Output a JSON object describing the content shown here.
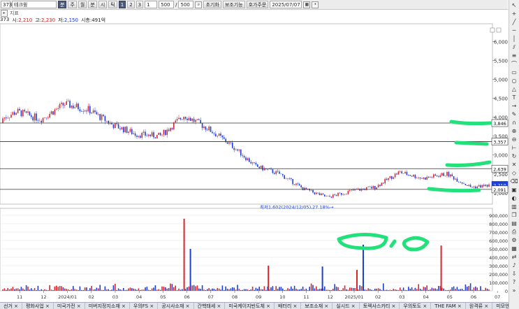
{
  "toolbar": {
    "code": "373",
    "name": "테크윙",
    "period_buttons": [
      "분",
      "주",
      "월",
      "분",
      "시",
      "틱"
    ],
    "selected_period_index": 0,
    "number_buttons": [
      "1",
      "2",
      "3"
    ],
    "selected_number_index": 0,
    "unit_value": "1",
    "count_value": "500",
    "page_value": "500",
    "init_button": "초기화",
    "indicator_button": "보조기능",
    "recent_button": "호가주문",
    "date_value": "2025/07/07"
  },
  "subbar": {
    "label": "지표"
  },
  "info": {
    "code": "373",
    "open_label": "시:",
    "open": "2,210",
    "high_label": "고:",
    "high": "2,230",
    "low_label": "저:",
    "low": "2,150",
    "mcap_label": "시총:",
    "mcap": "491억"
  },
  "chart_data": {
    "type": "candlestick",
    "price_axis": {
      "ticks": [
        "6,000",
        "5,500",
        "5,000",
        "4,500",
        "4,000",
        "3,500",
        "3,000",
        "2,500",
        "2,000"
      ],
      "range": [
        1700,
        6400
      ]
    },
    "volume_axis": {
      "ticks": [
        "900,000",
        "800,000",
        "700,000",
        "600,000",
        "500,000",
        "400,000",
        "300,000",
        "200,000",
        "100,000",
        "0"
      ],
      "range": [
        0,
        950000
      ]
    },
    "x_ticks": [
      "11",
      "12",
      "2024/01",
      "02",
      "03",
      "04",
      "05",
      "06",
      "07",
      "08",
      "09",
      "10",
      "11",
      "12",
      "2025/01",
      "02",
      "03",
      "04",
      "05",
      "06",
      "07"
    ],
    "price_path": [
      [
        "2023-10",
        3850
      ],
      [
        "2023-11",
        4150
      ],
      [
        "2023-12",
        3950
      ],
      [
        "2024-01",
        4350
      ],
      [
        "2024-02",
        4200
      ],
      [
        "2024-03",
        3800
      ],
      [
        "2024-04",
        3550
      ],
      [
        "2024-05",
        3500
      ],
      [
        "2024-06",
        4050
      ],
      [
        "2024-07",
        3700
      ],
      [
        "2024-08",
        3250
      ],
      [
        "2024-09",
        2700
      ],
      [
        "2024-10",
        2500
      ],
      [
        "2024-11",
        2100
      ],
      [
        "2024-12",
        1880
      ],
      [
        "2025-01",
        2050
      ],
      [
        "2025-02",
        2150
      ],
      [
        "2025-03",
        2550
      ],
      [
        "2025-04",
        2380
      ],
      [
        "2025-05",
        2500
      ],
      [
        "2025-06",
        2150
      ],
      [
        "2025-07",
        2210
      ]
    ],
    "horizontal_lines": [
      {
        "price": 3846,
        "label": "3,846"
      },
      {
        "price": 3357,
        "label": "3,357"
      },
      {
        "price": 2639,
        "label": "2,639"
      },
      {
        "price": 2210,
        "label": "2,210"
      },
      {
        "price": 2091,
        "label": "2,091"
      }
    ],
    "low_annotation": "최저1,602(2024/12/05),27.18%→",
    "volume_spikes": [
      {
        "month": "2024-06",
        "volume": 860000
      },
      {
        "month": "2024-06",
        "volume": 500000
      },
      {
        "month": "2024-09",
        "volume": 300000
      },
      {
        "month": "2024-11",
        "volume": 290000
      },
      {
        "month": "2025-01",
        "volume": 250000
      },
      {
        "month": "2025-01",
        "volume": 550000
      },
      {
        "month": "2025-04",
        "volume": 540000
      }
    ],
    "colors": {
      "up": "#d8262b",
      "down": "#1c3fd6",
      "line": "#333333",
      "highlight": "#22e07a",
      "grid": "#e4e4e4"
    }
  },
  "tabs": [
    "선거",
    "평화사업",
    "미국가전",
    "미버지정지소재",
    "우의FS",
    "공시사소재",
    "간핵태세",
    "미국케이지반도체",
    "배터리",
    "보조소재",
    "실시드",
    "토렉사스카티",
    "우의토도",
    "THE FAM",
    "원격류",
    "미모엔대다"
  ]
}
